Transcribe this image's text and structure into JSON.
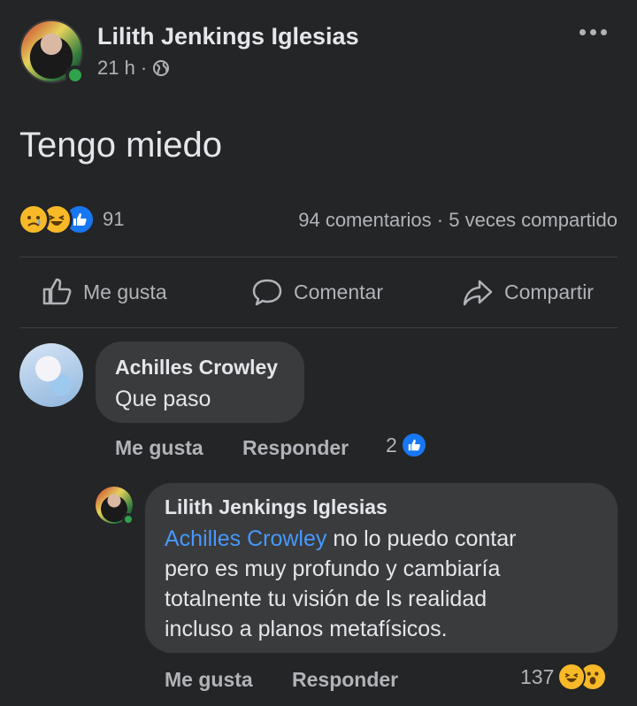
{
  "post": {
    "author": "Lilith Jenkings Iglesias",
    "time": "21 h",
    "separator": "·",
    "text": "Tengo miedo",
    "reaction_count": "91",
    "comments_count": "94 comentarios",
    "stats_separator": "·",
    "shares": "5 veces compartido"
  },
  "actions": {
    "like": "Me gusta",
    "comment": "Comentar",
    "share": "Compartir"
  },
  "comments": [
    {
      "author": "Achilles Crowley",
      "text": "Que paso",
      "like_label": "Me gusta",
      "reply_label": "Responder",
      "reactions": "2"
    }
  ],
  "replies": [
    {
      "author": "Lilith Jenkings Iglesias",
      "mention": "Achilles Crowley",
      "text_line1": " no lo puedo contar",
      "text_line2": "pero es muy profundo y cambiaría",
      "text_line3": "totalnente tu visión de ls realidad",
      "text_line4": "incluso a planos metafísicos.",
      "like_label": "Me gusta",
      "reply_label": "Responder",
      "reactions": "137"
    }
  ],
  "colors": {
    "background": "#242526",
    "bubble": "#3a3b3c",
    "accent_blue": "#1877f2",
    "mention": "#4599ff",
    "online": "#31a24c",
    "reaction_yellow": "#f7b928"
  },
  "icons": {
    "privacy": "globe-icon",
    "menu": "more-horizontal-icon",
    "like": "thumbs-up-icon",
    "comment": "speech-bubble-icon",
    "share": "share-arrow-icon"
  }
}
